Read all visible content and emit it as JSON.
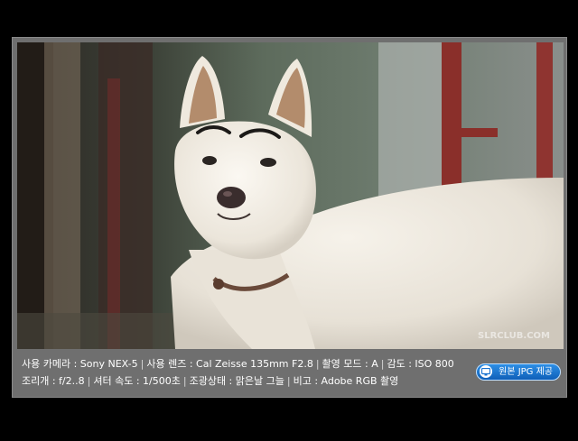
{
  "photo": {
    "subject": "white dog",
    "watermark": "SLRCLUB.COM"
  },
  "exif": {
    "camera_label": "사용 카메라 : Sony NEX-5",
    "lens_label": "사용 렌즈 : Cal Zeisse 135mm F2.8",
    "mode_label": "촬영 모드 : A",
    "iso_label": "감도 : ISO 800",
    "aperture_label": "조리개 : f/2..8",
    "shutter_label": "셔터 속도 : 1/500초",
    "lighting_label": "조광상태 : 맑은날 그늘",
    "note_label": "비고 : Adobe RGB 촬영"
  },
  "download": {
    "label": "원본 JPG 제공",
    "icon": "monitor-icon"
  },
  "colors": {
    "panel": "#6f6f6f",
    "button": "#1a73d0",
    "background": "#000000"
  }
}
